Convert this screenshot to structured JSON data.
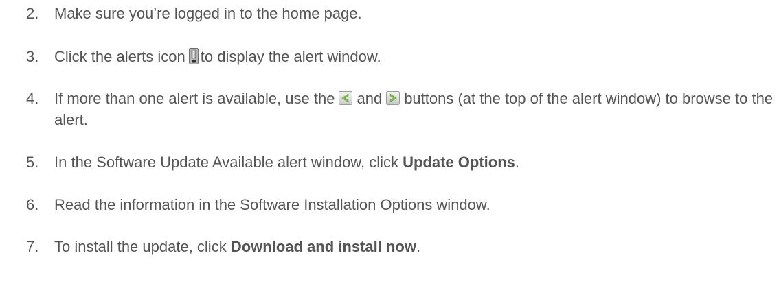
{
  "steps": [
    {
      "number": "2.",
      "text": "Make sure you’re logged in to the home page."
    },
    {
      "number": "3.",
      "pre": "Click the alerts icon",
      "post": "to display the alert window."
    },
    {
      "number": "4.",
      "pre": "If more than one alert is available, use the",
      "mid": "and",
      "post": "buttons (at the top of the alert window) to browse to the alert."
    },
    {
      "number": "5.",
      "pre": "In the Software Update Available alert window, click",
      "bold": "Update Options",
      "post": "."
    },
    {
      "number": "6.",
      "text": "Read the information in the Software Installation Options window."
    },
    {
      "number": "7.",
      "pre": "To install the update, click",
      "bold": "Download and install now",
      "post": "."
    }
  ],
  "icons": {
    "alert": "alert-exclamation-icon",
    "prev": "previous-arrow-icon",
    "next": "next-arrow-icon"
  }
}
